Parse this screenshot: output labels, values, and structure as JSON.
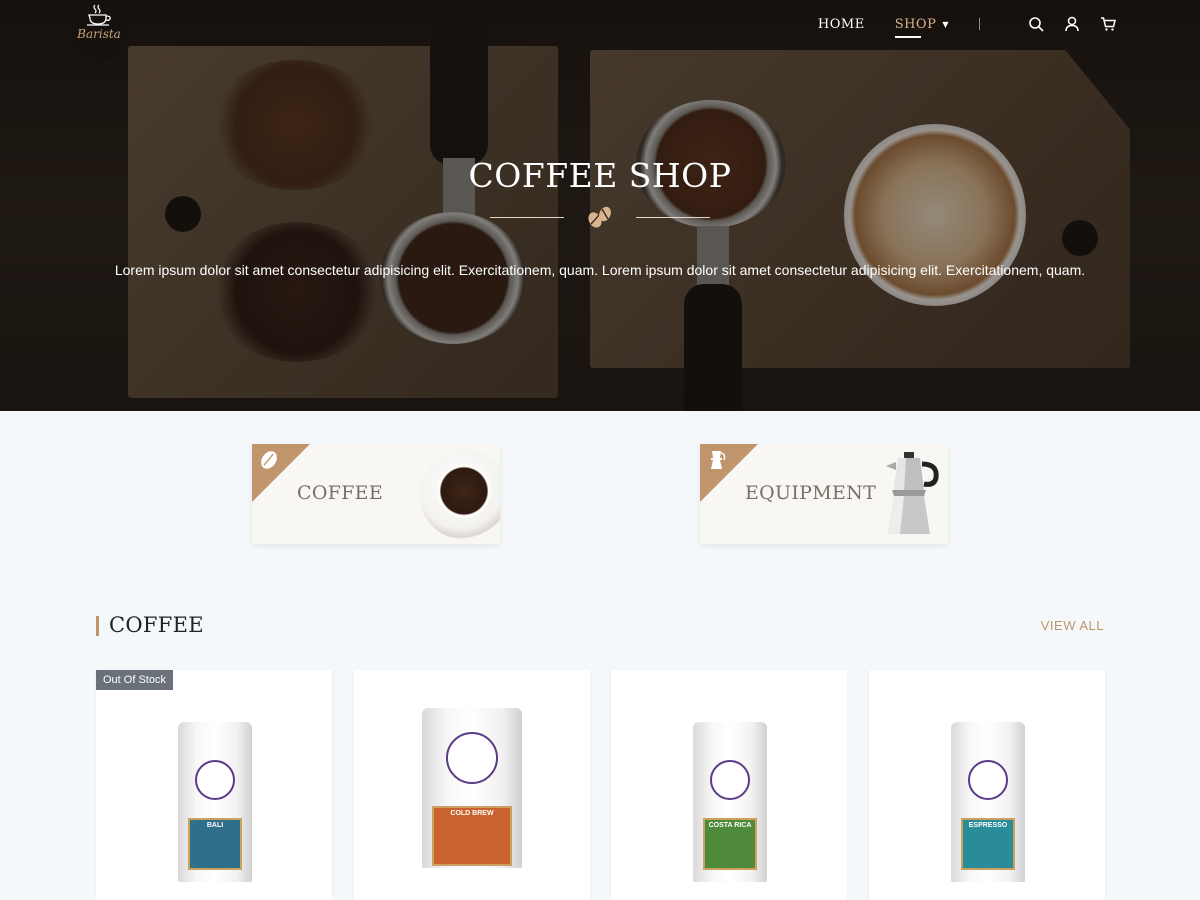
{
  "brand": {
    "name": "Barista"
  },
  "nav": {
    "links": [
      {
        "label": "HOME",
        "active": false
      },
      {
        "label": "SHOP",
        "active": true
      }
    ],
    "icons": [
      "search-icon",
      "user-icon",
      "cart-icon"
    ]
  },
  "hero": {
    "title": "COFFEE SHOP",
    "subtitle": "Lorem ipsum dolor sit amet consectetur adipisicing elit. Exercitationem, quam. Lorem ipsum dolor sit amet consectetur adipisicing elit. Exercitationem, quam."
  },
  "categories": [
    {
      "label": "COFFEE",
      "icon": "coffee-bean-icon"
    },
    {
      "label": "EQUIPMENT",
      "icon": "moka-pot-icon"
    }
  ],
  "coffee_section": {
    "title": "COFFEE",
    "view_all": "VIEW ALL"
  },
  "products": [
    {
      "badge": "Out Of Stock",
      "label": "BALI",
      "label_color": "#2f6f8a"
    },
    {
      "badge": "",
      "label": "COLD BREW",
      "label_color": "#c9622f"
    },
    {
      "badge": "",
      "label": "COSTA RICA",
      "label_color": "#4f8a3b"
    },
    {
      "badge": "",
      "label": "ESPRESSO",
      "label_color": "#2a8c98"
    }
  ],
  "colors": {
    "accent": "#c0956c",
    "background": "#f5f8fb",
    "badge": "#6b717a"
  }
}
